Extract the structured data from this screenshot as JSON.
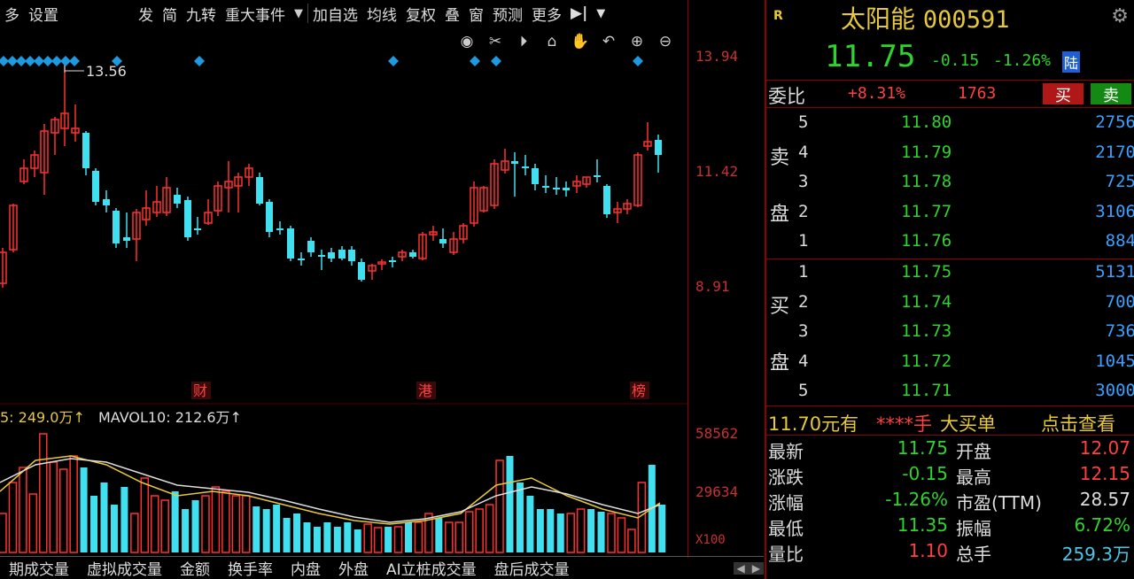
{
  "toolbar": {
    "items": [
      "多",
      "设置",
      "发",
      "简",
      "九转",
      "重大事件",
      "加自选",
      "均线",
      "复权",
      "叠",
      "窗",
      "预测",
      "更多"
    ]
  },
  "chart_toolbar_icons": [
    "eye-icon",
    "scissors-icon",
    "play-icon",
    "lock-icon",
    "hand-icon",
    "undo-icon",
    "zoom-in-icon",
    "zoom-out-icon"
  ],
  "price_axis": {
    "top": "13.94",
    "mid": "11.42",
    "low": "8.91"
  },
  "high_label": "13.56",
  "events": {
    "cai": "财",
    "gang": "港",
    "bang": "榜"
  },
  "volume": {
    "ma5_label": "5: 249.0万↑",
    "ma10_label": "MAVOL10: 212.6万↑",
    "axis_top": "58562",
    "axis_mid": "29634",
    "axis_unit": "X100"
  },
  "bottom_tabs": [
    "期成交量",
    "虚拟成交量",
    "金额",
    "换手率",
    "内盘",
    "外盘",
    "AI立桩成交量",
    "盘后成交量"
  ],
  "quote": {
    "r_badge": "R",
    "name": "太阳能",
    "code": "000591",
    "price": "11.75",
    "change": "-0.15",
    "change_pct": "-1.26%",
    "exchange_badge": "陆",
    "weibi_label": "委比",
    "weibi_value": "+8.31%",
    "weicha": "1763",
    "buy_btn": "买",
    "sell_btn": "卖",
    "sell_label_1": "卖",
    "sell_label_2": "盘",
    "buy_label_1": "买",
    "buy_label_2": "盘"
  },
  "sell_levels": [
    {
      "level": "5",
      "price": "11.80",
      "volume": "2756"
    },
    {
      "level": "4",
      "price": "11.79",
      "volume": "2170"
    },
    {
      "level": "3",
      "price": "11.78",
      "volume": "725"
    },
    {
      "level": "2",
      "price": "11.77",
      "volume": "3106"
    },
    {
      "level": "1",
      "price": "11.76",
      "volume": "884"
    }
  ],
  "buy_levels": [
    {
      "level": "1",
      "price": "11.75",
      "volume": "5131"
    },
    {
      "level": "2",
      "price": "11.74",
      "volume": "700"
    },
    {
      "level": "3",
      "price": "11.73",
      "volume": "736"
    },
    {
      "level": "4",
      "price": "11.72",
      "volume": "1045"
    },
    {
      "level": "5",
      "price": "11.71",
      "volume": "3000"
    }
  ],
  "big_order": {
    "price": "11.70元有",
    "hands": "****手",
    "label": "大买单",
    "link": "点击查看"
  },
  "stats": [
    {
      "label": "最新",
      "value": "11.75",
      "label2": "开盘",
      "value2": "12.07"
    },
    {
      "label": "涨跌",
      "value": "-0.15",
      "label2": "最高",
      "value2": "12.15"
    },
    {
      "label": "涨幅",
      "value": "-1.26%",
      "label2": "市盈(TTM)",
      "value2": "28.57"
    },
    {
      "label": "最低",
      "value": "11.35",
      "label2": "振幅",
      "value2": "6.72%"
    },
    {
      "label": "量比",
      "value": "1.10",
      "label2": "总手",
      "value2": "259.3万"
    }
  ],
  "colors": {
    "up": "#ff3030",
    "down": "#40e0f0",
    "accent": "#e6c83a",
    "diamond": "#1e9be0"
  }
}
